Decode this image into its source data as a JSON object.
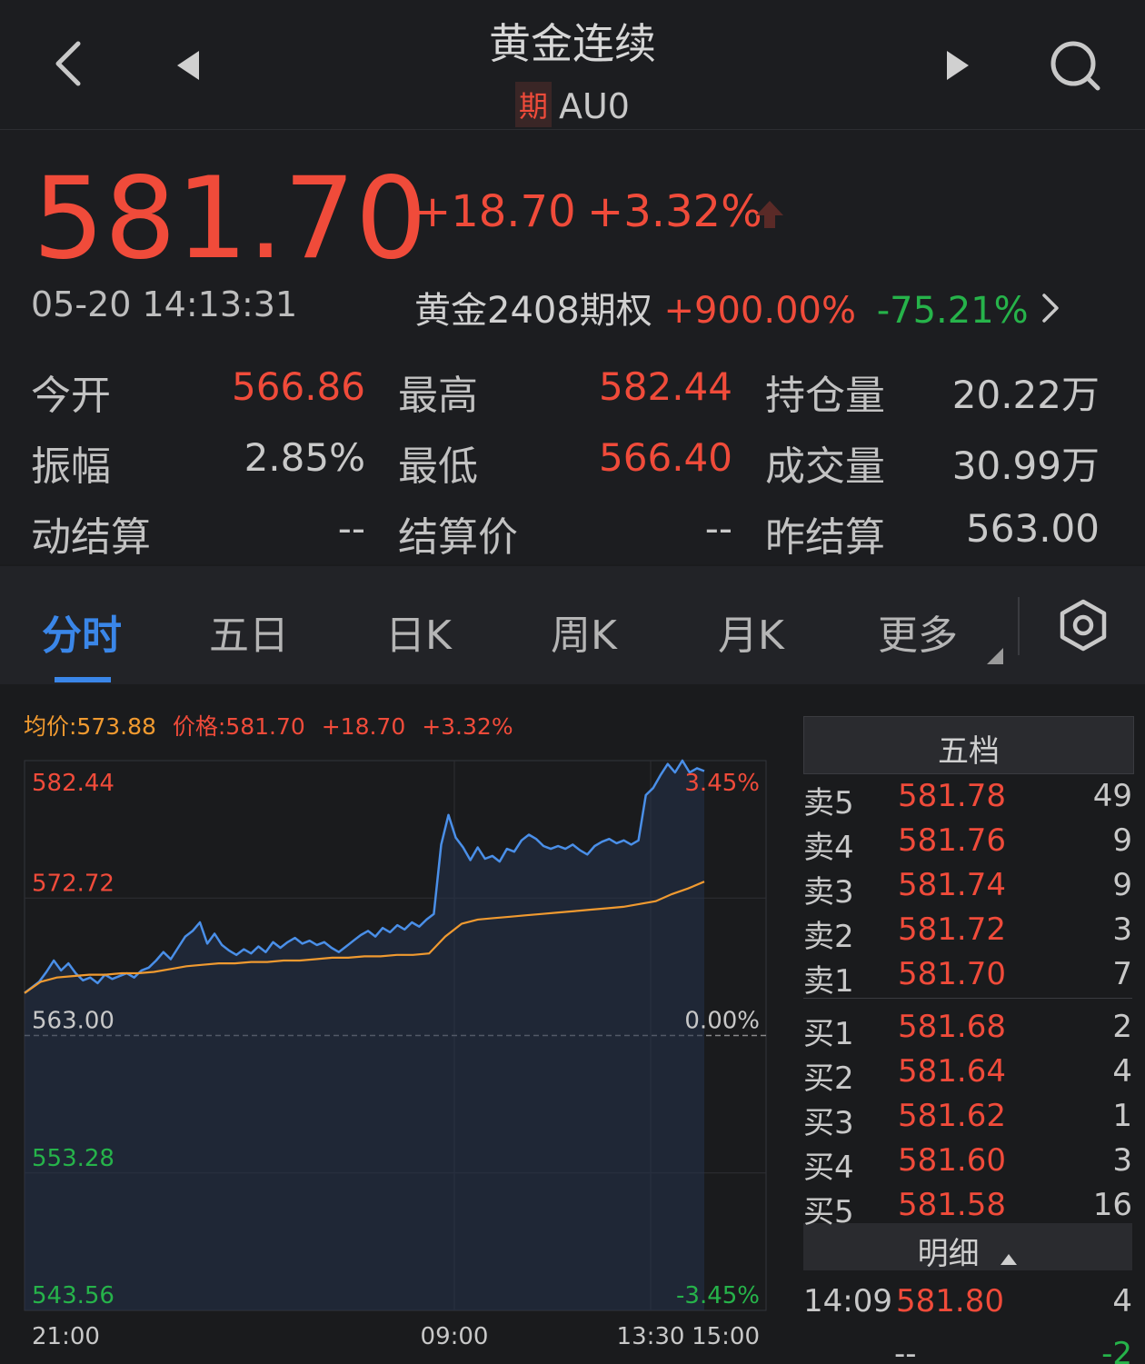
{
  "header": {
    "back_icon": "chevron-left-icon",
    "prev_icon": "triangle-left-icon",
    "next_icon": "triangle-right-icon",
    "search_icon": "search-icon",
    "title": "黄金连续",
    "badge": "期",
    "code": "AU0"
  },
  "quote": {
    "price": "581.70",
    "change": "+18.70",
    "change_pct": "+3.32%",
    "datetime": "05-20 14:13:31",
    "option_name": "黄金2408期权",
    "option_up": "+900.00%",
    "option_down": "-75.21%",
    "colors": {
      "up": "#f04b3a",
      "down": "#26b34a"
    }
  },
  "stats": [
    {
      "label": "今开",
      "value": "566.86",
      "color": "red"
    },
    {
      "label": "最高",
      "value": "582.44",
      "color": "red"
    },
    {
      "label": "持仓量",
      "value": "20.22万",
      "color": "grey"
    },
    {
      "label": "振幅",
      "value": "2.85%",
      "color": "grey"
    },
    {
      "label": "最低",
      "value": "566.40",
      "color": "red"
    },
    {
      "label": "成交量",
      "value": "30.99万",
      "color": "grey"
    },
    {
      "label": "动结算",
      "value": "--",
      "color": "grey"
    },
    {
      "label": "结算价",
      "value": "--",
      "color": "grey"
    },
    {
      "label": "昨结算",
      "value": "563.00",
      "color": "grey"
    }
  ],
  "tabs": {
    "items": [
      "分时",
      "五日",
      "日K",
      "周K",
      "月K",
      "更多"
    ],
    "active": "分时",
    "settings_icon": "hexagon-settings-icon"
  },
  "chart_info": {
    "avg_label": "均价:573.88",
    "price_label": "价格:581.70",
    "change": "+18.70",
    "change_pct": "+3.32%"
  },
  "chart_data": {
    "type": "line",
    "y_labels_left": [
      "582.44",
      "572.72",
      "563.00",
      "553.28",
      "543.56"
    ],
    "y_labels_right": [
      "3.45%",
      "0.00%",
      "-3.45%"
    ],
    "x_labels": [
      "21:00",
      "09:00",
      "13:30",
      "15:00"
    ],
    "ylim": [
      543.56,
      582.44
    ],
    "prev_settle": 563.0,
    "series": [
      {
        "name": "价格",
        "color": "#4a8fe8",
        "values": [
          566.0,
          566.4,
          566.8,
          567.5,
          568.3,
          567.6,
          568.1,
          567.4,
          566.9,
          567.1,
          566.7,
          567.3,
          567.0,
          567.2,
          567.4,
          567.1,
          567.6,
          567.8,
          568.3,
          568.9,
          568.4,
          569.2,
          570.0,
          570.4,
          571.0,
          569.5,
          570.2,
          569.4,
          569.0,
          568.7,
          569.1,
          568.8,
          569.3,
          568.9,
          569.6,
          569.2,
          569.6,
          569.9,
          569.5,
          569.7,
          569.4,
          569.6,
          569.2,
          568.9,
          569.3,
          569.7,
          570.1,
          570.4,
          570.0,
          570.6,
          570.3,
          570.8,
          570.5,
          571.0,
          570.7,
          571.2,
          571.6,
          576.5,
          578.6,
          577.0,
          576.3,
          575.4,
          576.3,
          575.5,
          575.7,
          575.3,
          576.2,
          576.0,
          576.8,
          577.2,
          576.9,
          576.4,
          576.2,
          576.4,
          576.2,
          576.5,
          576.1,
          575.8,
          576.4,
          576.7,
          576.9,
          576.6,
          576.8,
          576.5,
          576.8,
          580.0,
          580.5,
          581.4,
          582.2,
          581.6,
          582.44,
          581.6,
          581.9,
          581.7
        ],
        "x_end": 0.999
      },
      {
        "name": "均价",
        "color": "#f09a30",
        "values": [
          566.0,
          566.8,
          567.1,
          567.2,
          567.3,
          567.3,
          567.4,
          567.4,
          567.5,
          567.7,
          567.9,
          568.0,
          568.1,
          568.1,
          568.2,
          568.2,
          568.3,
          568.3,
          568.4,
          568.5,
          568.5,
          568.6,
          568.6,
          568.7,
          568.7,
          568.8,
          570.0,
          570.9,
          571.2,
          571.3,
          571.4,
          571.5,
          571.6,
          571.7,
          571.8,
          571.9,
          572.0,
          572.1,
          572.3,
          572.5,
          573.0,
          573.4,
          573.88
        ]
      }
    ]
  },
  "order_book": {
    "title": "五档",
    "asks": [
      {
        "label": "卖5",
        "price": "581.78",
        "qty": "49"
      },
      {
        "label": "卖4",
        "price": "581.76",
        "qty": "9"
      },
      {
        "label": "卖3",
        "price": "581.74",
        "qty": "9"
      },
      {
        "label": "卖2",
        "price": "581.72",
        "qty": "3"
      },
      {
        "label": "卖1",
        "price": "581.70",
        "qty": "7"
      }
    ],
    "bids": [
      {
        "label": "买1",
        "price": "581.68",
        "qty": "2"
      },
      {
        "label": "买2",
        "price": "581.64",
        "qty": "4"
      },
      {
        "label": "买3",
        "price": "581.62",
        "qty": "1"
      },
      {
        "label": "买4",
        "price": "581.60",
        "qty": "3"
      },
      {
        "label": "买5",
        "price": "581.58",
        "qty": "16"
      }
    ],
    "detail_title": "明细",
    "detail_icon": "caret-up-icon",
    "trades": [
      {
        "time": "14:09",
        "price": "581.80",
        "qty": "4"
      }
    ],
    "trade_partial": {
      "time": "--",
      "qty": "-2"
    }
  }
}
